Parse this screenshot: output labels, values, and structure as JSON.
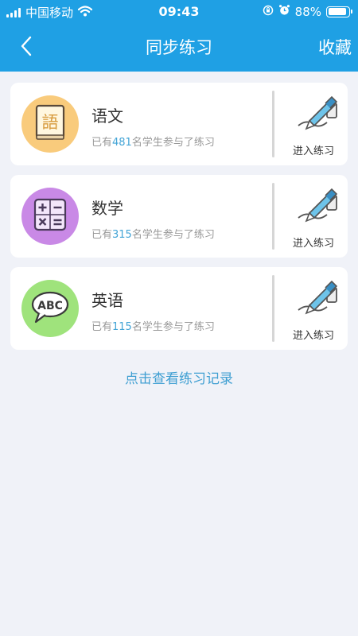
{
  "status_bar": {
    "carrier": "中国移动",
    "time": "09:43",
    "battery_percent": "88%",
    "battery_level": 0.88,
    "icons": [
      "signal-icon",
      "wifi-icon",
      "orientation-lock-icon",
      "alarm-icon",
      "battery-icon"
    ]
  },
  "nav": {
    "back_icon": "chevron-left-icon",
    "title": "同步练习",
    "right": "收藏"
  },
  "subjects": [
    {
      "name": "语文",
      "icon": "chinese-book-icon",
      "icon_bg": "#f9cb7c",
      "prefix": "已有",
      "count": "481",
      "suffix": "名学生参与了练习",
      "action": "进入练习",
      "action_icon": "pen-writing-icon"
    },
    {
      "name": "数学",
      "icon": "calculator-icon",
      "icon_bg": "#c989e6",
      "prefix": "已有",
      "count": "315",
      "suffix": "名学生参与了练习",
      "action": "进入练习",
      "action_icon": "pen-writing-icon"
    },
    {
      "name": "英语",
      "icon": "abc-speech-bubble-icon",
      "icon_bg": "#9fe37c",
      "prefix": "已有",
      "count": "115",
      "suffix": "名学生参与了练习",
      "action": "进入练习",
      "action_icon": "pen-writing-icon"
    }
  ],
  "records_link": "点击查看练习记录",
  "colors": {
    "header": "#1fa0e4",
    "background": "#f0f2f8",
    "count_highlight": "#43a4d6",
    "link": "#3f9fd2"
  }
}
